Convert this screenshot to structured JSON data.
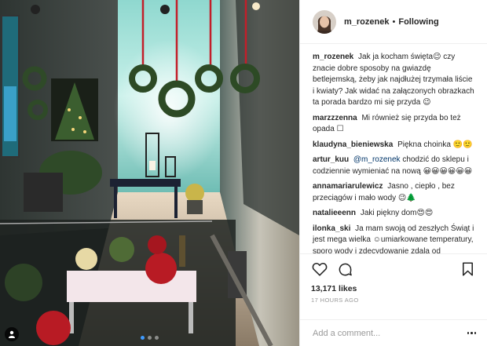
{
  "header": {
    "username": "m_rozenek",
    "separator": "•",
    "follow_status": "Following"
  },
  "comments": [
    {
      "user": "m_rozenek",
      "text": "Jak ja kocham święta😉 czy znacie dobre sposoby na gwiazdę betlejemską, żeby jak najdłużej trzymała liście i kwiaty? Jak widać na załączonych obrazkach ta porada bardzo mi się przyda 😉"
    },
    {
      "user": "marzzzenna",
      "text": "Mi również się przyda bo też opada ☐"
    },
    {
      "user": "klaudyna_bieniewska",
      "text": "Piękna choinka 🙂🙂"
    },
    {
      "user": "artur_kuu",
      "mention": "@m_rozenek",
      "text": "chodzić do sklepu i codziennie wymieniać na nową 😀😀😀😀😀😀"
    },
    {
      "user": "annamariarulewicz",
      "text": "Jasno , ciepło , bez przeciągów i mało wody 😉🌲"
    },
    {
      "user": "natalieeenn",
      "text": "Jaki piękny dom😍😍"
    },
    {
      "user": "ilonka_ski",
      "text": "Ja mam swoją od zeszłych Świąt i jest mega wielka ☺umiarkowane temperatury, sporo wody i zdecydowanie zdala od przeciągów. Wesołych Świąt ✨"
    }
  ],
  "stats": {
    "likes": "13,171 likes",
    "time": "17 HOURS AGO"
  },
  "add_comment": {
    "placeholder": "Add a comment..."
  },
  "icons": {
    "like": "heart-icon",
    "comment": "comment-bubble-icon",
    "save": "bookmark-icon",
    "more": "more-options-icon",
    "tag": "user-tag-icon"
  },
  "carousel": {
    "count": 3,
    "active_index": 0
  },
  "colors": {
    "text": "#262626",
    "muted": "#999999",
    "border": "#efefef",
    "mention": "#003569",
    "carousel_active": "#3f9bff"
  }
}
